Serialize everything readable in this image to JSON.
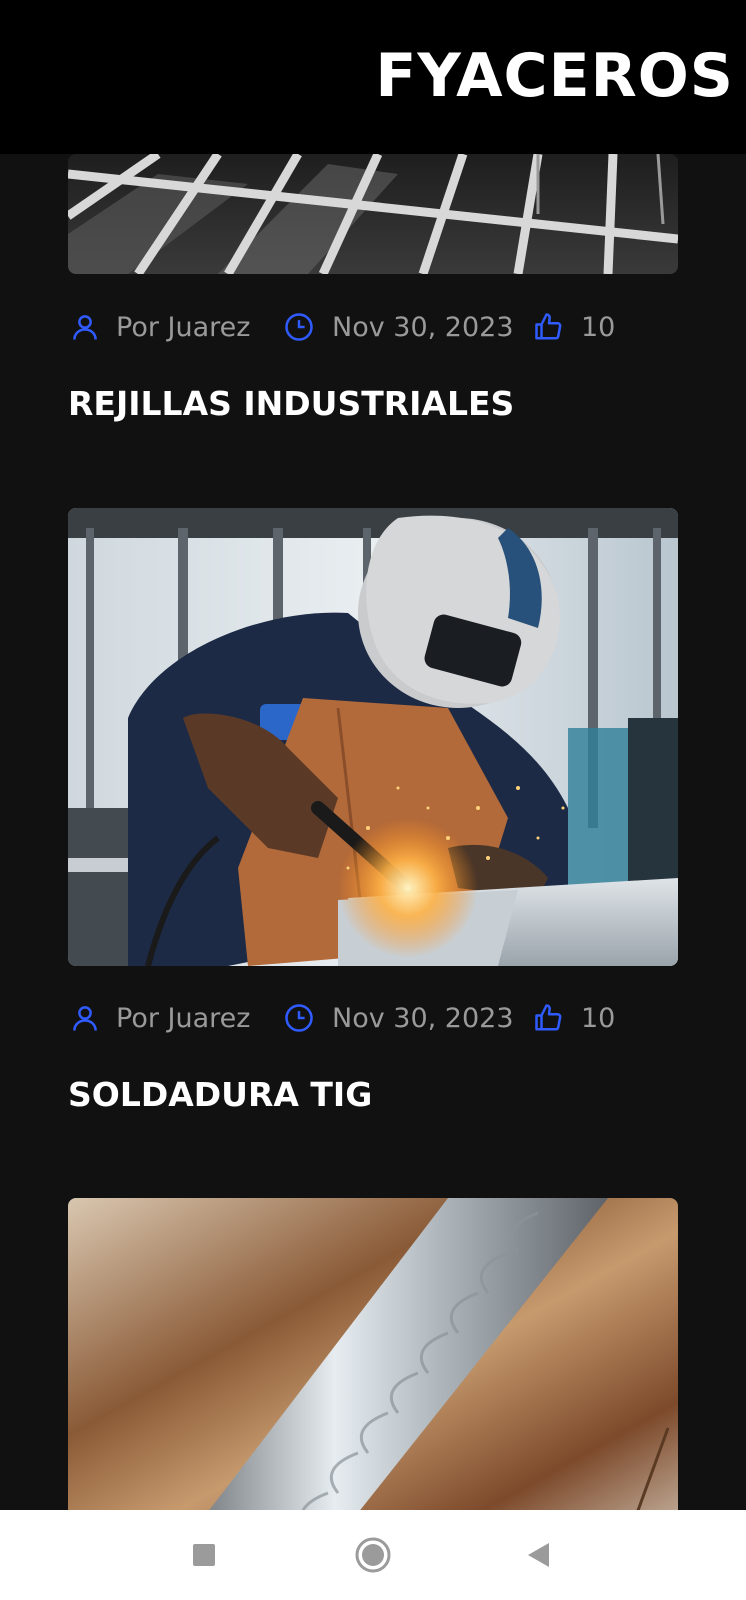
{
  "header": {
    "brand": "FYACEROS"
  },
  "posts": [
    {
      "author": "Por Juarez",
      "date": "Nov 30, 2023",
      "likes": "10",
      "title": "REJILLAS INDUSTRIALES",
      "image_icon": "steel-grating-image"
    },
    {
      "author": "Por Juarez",
      "date": "Nov 30, 2023",
      "likes": "10",
      "title": "SOLDADURA TIG",
      "image_icon": "welder-image"
    },
    {
      "image_icon": "weld-bead-image"
    }
  ],
  "colors": {
    "accent": "#2f5bff",
    "background": "#111111",
    "header": "#000000",
    "meta_text": "#9a9a9a"
  },
  "system_nav": {
    "buttons": [
      "recents-button",
      "home-button",
      "back-button"
    ]
  }
}
